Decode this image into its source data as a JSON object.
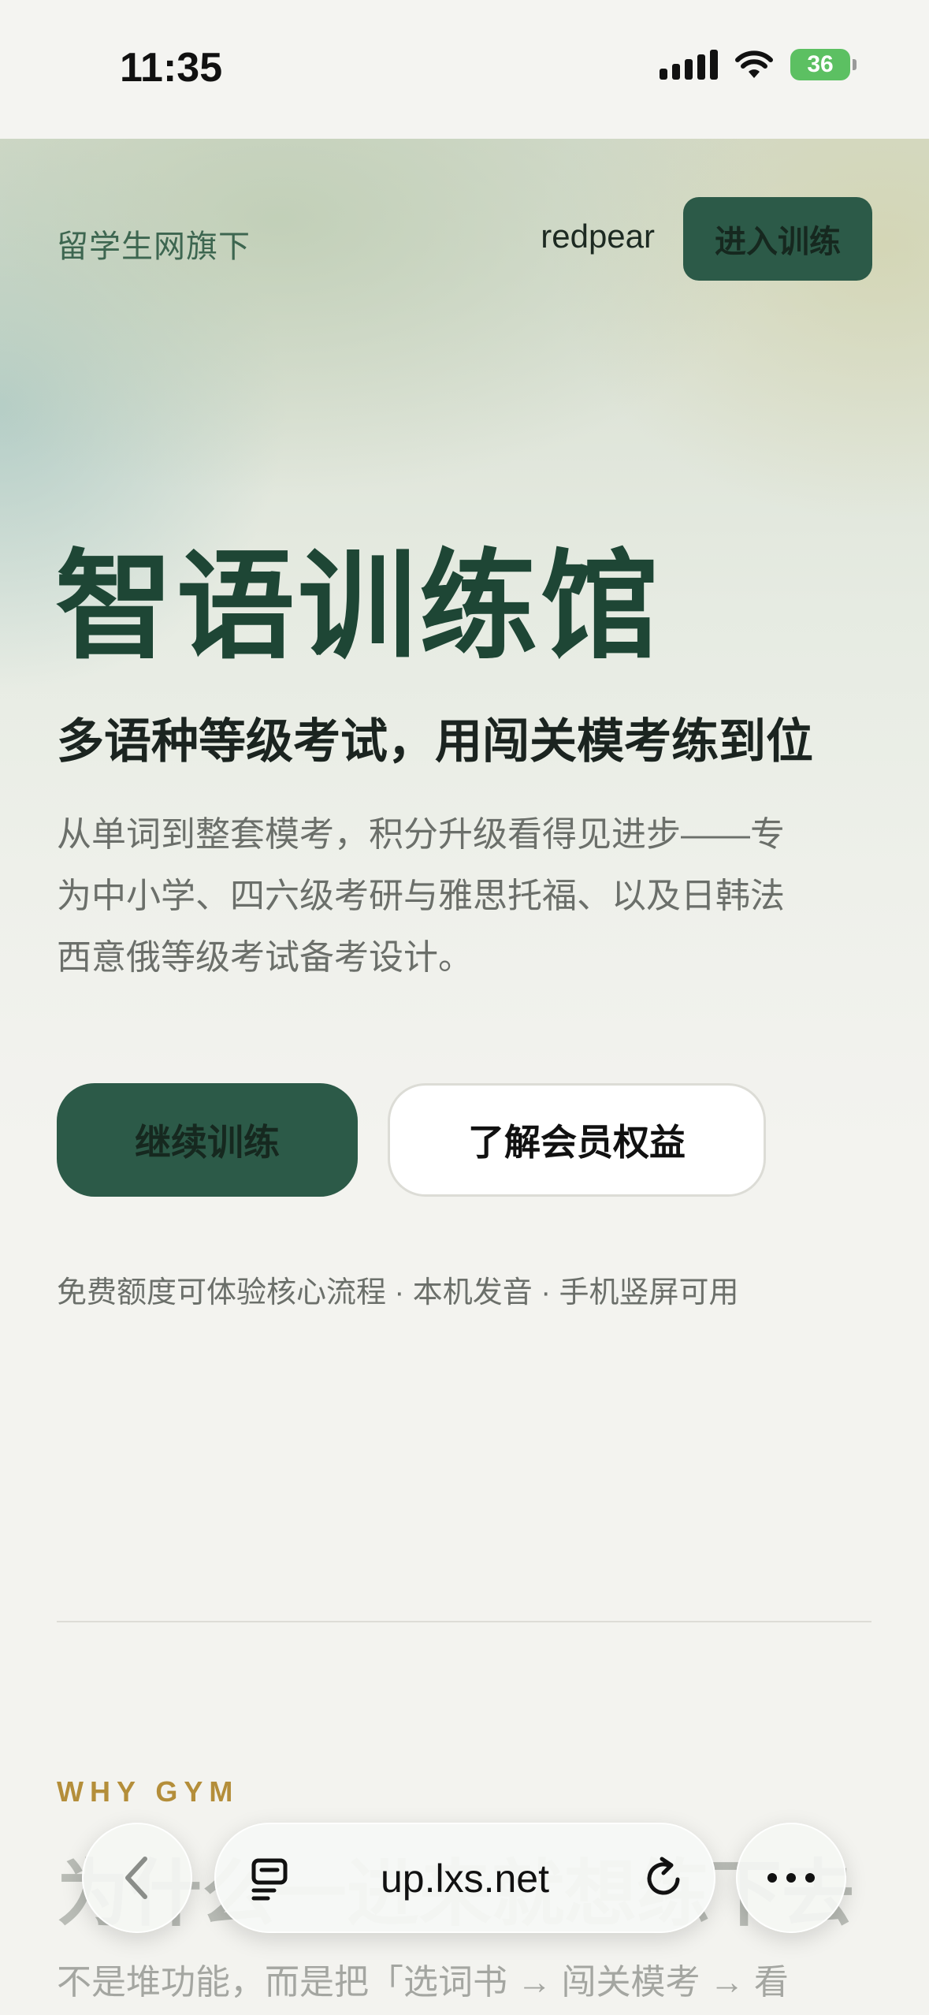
{
  "status_bar": {
    "time": "11:35",
    "battery": "36"
  },
  "header": {
    "brand_sub": "留学生网旗下",
    "brand_name": "redpear",
    "enter_button": "进入训练"
  },
  "hero": {
    "title": "智语训练馆",
    "subtitle": "多语种等级考试，用闯关模考练到位",
    "description_lines": [
      "从单词到整套模考，积分升级看得见进步——专",
      "为中小学、四六级考研与雅思托福、以及日韩法",
      "西意俄等级考试备考设计。"
    ],
    "primary_button": "继续训练",
    "secondary_button": "了解会员权益",
    "note": "免费额度可体验核心流程 · 本机发音 · 手机竖屏可用"
  },
  "section": {
    "eyebrow": "WHY GYM",
    "heading": "为什么一进来就想练下去",
    "description": "不是堆功能，而是把「选词书 → 闯关模考 → 看"
  },
  "browser": {
    "url": "up.lxs.net"
  },
  "icons": [
    "signal-icon",
    "wifi-icon",
    "battery-icon",
    "back-chevron-icon",
    "tabs-icon",
    "reload-icon",
    "more-icon"
  ]
}
